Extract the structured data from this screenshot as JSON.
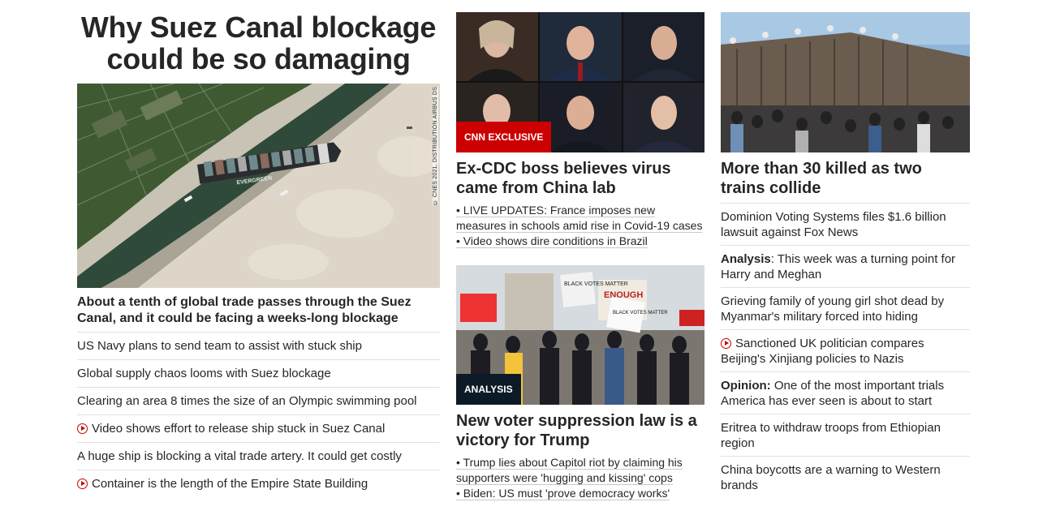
{
  "left": {
    "hero_title": "Why Suez Canal blockage could be so damaging",
    "hero_image_credit": "© CNES 2021, DISTRIBUTION AIRBUS DS",
    "hero_image_ship_text": "EVERGREEN",
    "hero_subhead": "About a tenth of global trade passes through the Suez Canal, and it could be facing a weeks-long blockage",
    "links": [
      {
        "text": "US Navy plans to send team to assist with stuck ship",
        "video": false
      },
      {
        "text": "Global supply chaos looms with Suez blockage",
        "video": false
      },
      {
        "text": "Clearing an area 8 times the size of an Olympic swimming pool",
        "video": false
      },
      {
        "text": "Video shows effort to release ship stuck in Suez Canal",
        "video": true
      },
      {
        "text": "A huge ship is blocking a vital trade artery. It could get costly",
        "video": false
      },
      {
        "text": "Container is the length of the Empire State Building",
        "video": true
      }
    ]
  },
  "middle": {
    "card1": {
      "badge": "CNN EXCLUSIVE",
      "title": "Ex-CDC boss believes virus came from China lab",
      "bullets": [
        "• LIVE UPDATES: France imposes new measures in schools amid rise in Covid-19 cases",
        "• Video shows dire conditions in Brazil"
      ]
    },
    "card2": {
      "badge": "ANALYSIS",
      "title": "New voter suppression law is a victory for Trump",
      "sign_texts": [
        "BLACK VOTES MATTER",
        "ENOUGH",
        "BLACK VOTES MATTER"
      ],
      "bullets": [
        "• Trump lies about Capitol riot by claiming his supporters were 'hugging and kissing' cops",
        "• Biden: US must 'prove democracy works'"
      ]
    }
  },
  "right": {
    "title": "More than 30 killed as two trains collide",
    "links": [
      {
        "prefix": "",
        "text": "Dominion Voting Systems files $1.6 billion lawsuit against Fox News",
        "video": false
      },
      {
        "prefix": "Analysis",
        "text": ": This week was a turning point for Harry and Meghan",
        "video": false
      },
      {
        "prefix": "",
        "text": "Grieving family of young girl shot dead by Myanmar's military forced into hiding",
        "video": false
      },
      {
        "prefix": "",
        "text": "Sanctioned UK politician compares Beijing's Xinjiang policies to Nazis",
        "video": true
      },
      {
        "prefix": "Opinion:",
        "text": " One of the most important trials America has ever seen is about to start",
        "video": false
      },
      {
        "prefix": "",
        "text": "Eritrea to withdraw troops from Ethiopian region",
        "video": false
      },
      {
        "prefix": "",
        "text": "China boycotts are a warning to Western brands",
        "video": false
      }
    ]
  },
  "colors": {
    "accent_red": "#cc0000",
    "badge_dark": "#0c1a27",
    "text": "#262626",
    "divider": "#e1e1e1"
  }
}
